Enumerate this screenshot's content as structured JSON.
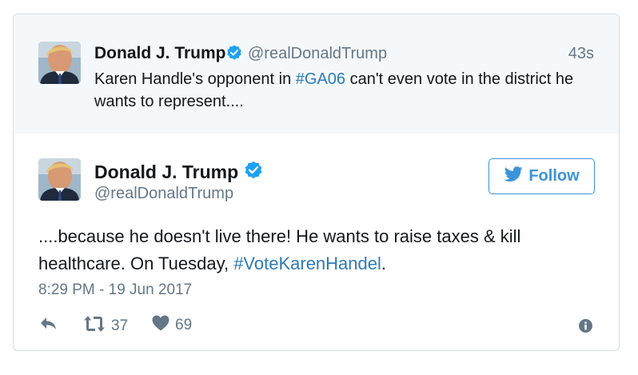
{
  "colors": {
    "link": "#2b7bb9",
    "verified": "#1da1f2",
    "follow_border": "#3b94d9",
    "muted": "#657786",
    "parent_bg": "#f5f8fa"
  },
  "parent_tweet": {
    "name": "Donald J. Trump",
    "handle": "@realDonaldTrump",
    "time": "43s",
    "text_before": "Karen Handle's opponent in ",
    "hashtag": "#GA06",
    "text_after": " can't even vote in the district he wants to represent...."
  },
  "main_tweet": {
    "name": "Donald J. Trump",
    "handle": "@realDonaldTrump",
    "follow_label": "Follow",
    "text_before": "....because he doesn't live there! He wants to raise taxes & kill healthcare. On Tuesday, ",
    "hashtag": "#VoteKarenHandel",
    "text_after": ".",
    "timestamp": "8:29 PM - 19 Jun 2017",
    "retweet_count": "37",
    "like_count": "69"
  },
  "icons": {
    "verified": "verified-badge-icon",
    "follow_bird": "bird-icon",
    "reply": "reply-icon",
    "retweet": "retweet-icon",
    "like": "heart-icon",
    "info": "info-icon"
  }
}
